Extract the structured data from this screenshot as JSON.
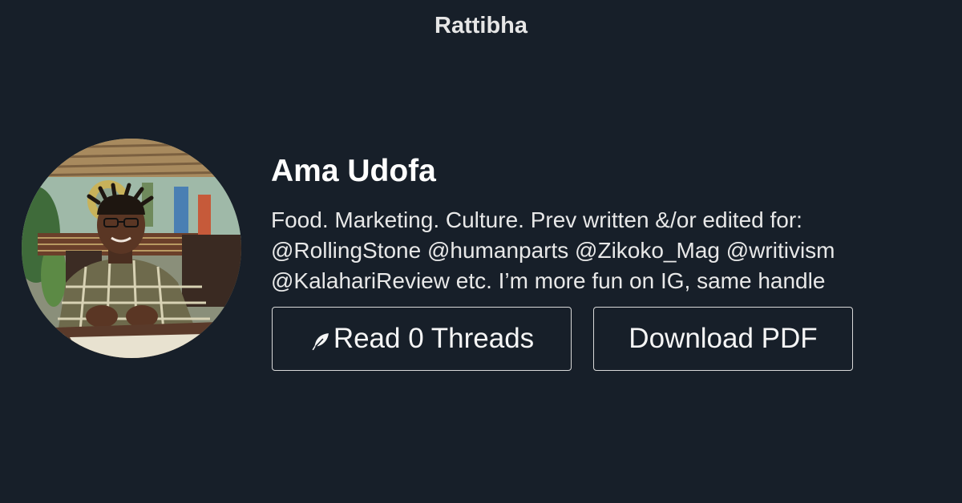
{
  "brand": "Rattibha",
  "profile": {
    "name": "Ama Udofa",
    "bio_lines": [
      "Food. Marketing. Culture. Prev written &/or edited for:",
      "@RollingStone @humanparts @Zikoko_Mag @writivism",
      "@KalahariReview etc. I’m more fun on IG, same handle"
    ]
  },
  "actions": {
    "read_icon": "feather-icon",
    "read_label": "Read 0 Threads",
    "pdf_label": "Download PDF"
  },
  "colors": {
    "background": "#171f29",
    "text": "#ffffff",
    "button_border": "#d9d9d9"
  }
}
